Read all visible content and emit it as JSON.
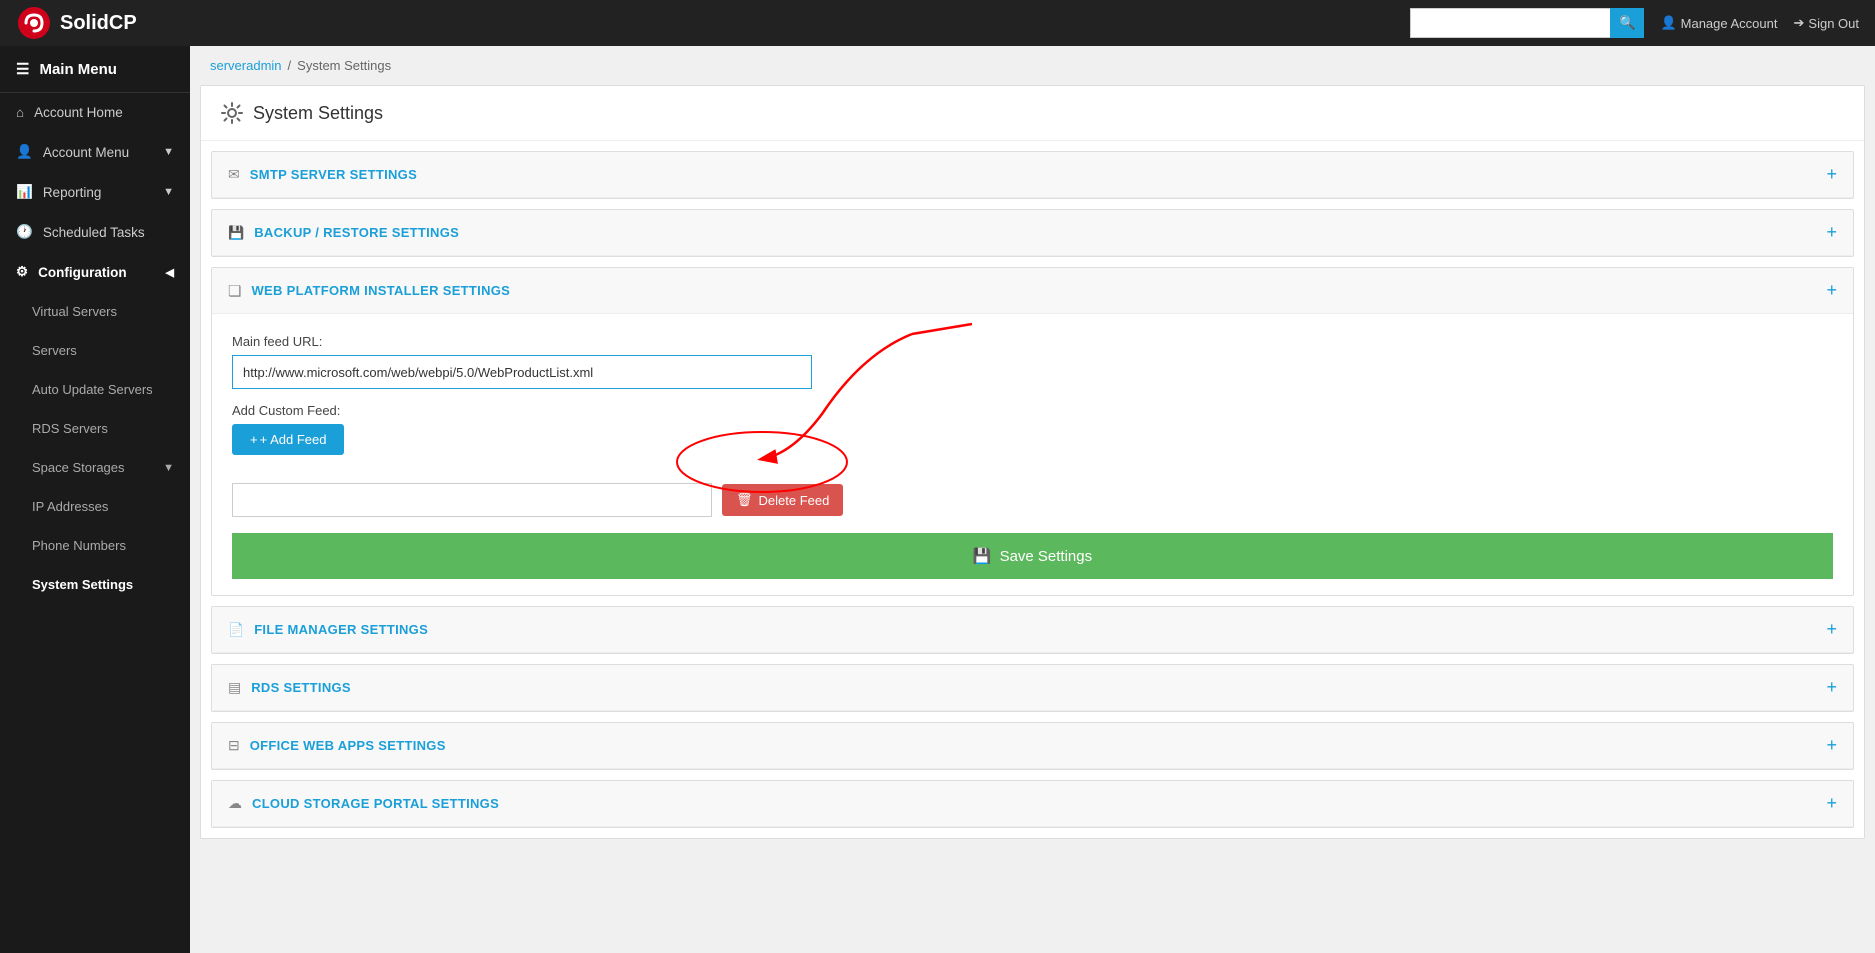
{
  "topNav": {
    "logoAlt": "SolidCP",
    "searchPlaceholder": "",
    "searchBtnLabel": "🔍",
    "manageAccountLabel": "Manage Account",
    "signOutLabel": "Sign Out"
  },
  "sidebar": {
    "mainMenuLabel": "Main Menu",
    "items": [
      {
        "id": "account-home",
        "label": "Account Home",
        "icon": "home",
        "active": false,
        "sub": false
      },
      {
        "id": "account-menu",
        "label": "Account Menu",
        "icon": "user",
        "active": false,
        "sub": false,
        "hasChevron": true
      },
      {
        "id": "reporting",
        "label": "Reporting",
        "icon": "chart",
        "active": false,
        "sub": false,
        "hasChevron": true
      },
      {
        "id": "scheduled-tasks",
        "label": "Scheduled Tasks",
        "icon": "clock",
        "active": false,
        "sub": false
      },
      {
        "id": "configuration",
        "label": "Configuration",
        "icon": "cog",
        "active": true,
        "sub": false,
        "hasChevron": true
      },
      {
        "id": "virtual-servers",
        "label": "Virtual Servers",
        "icon": "",
        "active": false,
        "sub": true
      },
      {
        "id": "servers",
        "label": "Servers",
        "icon": "",
        "active": false,
        "sub": true
      },
      {
        "id": "auto-update-servers",
        "label": "Auto Update Servers",
        "icon": "",
        "active": false,
        "sub": true
      },
      {
        "id": "rds-servers",
        "label": "RDS Servers",
        "icon": "",
        "active": false,
        "sub": true
      },
      {
        "id": "space-storages",
        "label": "Space Storages",
        "icon": "",
        "active": false,
        "sub": true,
        "hasChevron": true
      },
      {
        "id": "ip-addresses",
        "label": "IP Addresses",
        "icon": "",
        "active": false,
        "sub": true
      },
      {
        "id": "phone-numbers",
        "label": "Phone Numbers",
        "icon": "",
        "active": false,
        "sub": true
      },
      {
        "id": "system-settings",
        "label": "System Settings",
        "icon": "",
        "active": true,
        "sub": true
      }
    ]
  },
  "breadcrumb": {
    "parts": [
      "serveradmin",
      "System Settings"
    ]
  },
  "pageTitle": "System Settings",
  "sections": [
    {
      "id": "smtp",
      "icon": "envelope",
      "title": "SMTP SERVER SETTINGS",
      "expanded": false
    },
    {
      "id": "backup",
      "icon": "hdd",
      "title": "BACKUP / RESTORE SETTINGS",
      "expanded": false
    },
    {
      "id": "wpi",
      "icon": "windows",
      "title": "WEB PLATFORM INSTALLER SETTINGS",
      "expanded": true
    },
    {
      "id": "file-manager",
      "icon": "file",
      "title": "FILE MANAGER SETTINGS",
      "expanded": false
    },
    {
      "id": "rds",
      "icon": "table",
      "title": "RDS SETTINGS",
      "expanded": false
    },
    {
      "id": "office-web-apps",
      "icon": "apps",
      "title": "OFFICE WEB APPS SETTINGS",
      "expanded": false
    },
    {
      "id": "cloud-storage",
      "icon": "cloud",
      "title": "CLOUD STORAGE PORTAL SETTINGS",
      "expanded": false
    }
  ],
  "wpi": {
    "mainFeedLabel": "Main feed URL:",
    "mainFeedValue": "http://www.microsoft.com/web/webpi/5.0/WebProductList.xml",
    "addCustomFeedLabel": "Add Custom Feed:",
    "addFeedBtnLabel": "+ Add Feed",
    "customFeedValue": "",
    "deleteFeedBtnLabel": "Delete Feed",
    "saveSettingsBtnLabel": "Save Settings"
  }
}
